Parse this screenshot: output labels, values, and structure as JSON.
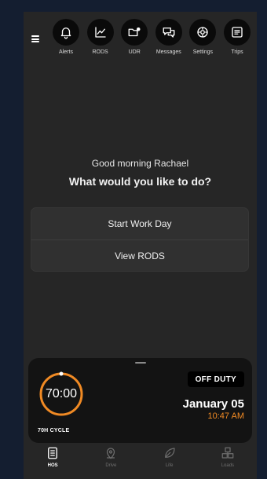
{
  "nav": {
    "items": [
      {
        "label": "Alerts",
        "icon": "bell-icon"
      },
      {
        "label": "RODS",
        "icon": "chart-icon"
      },
      {
        "label": "UDR",
        "icon": "folder-alert-icon"
      },
      {
        "label": "Messages",
        "icon": "chat-icon"
      },
      {
        "label": "Settings",
        "icon": "gear-icon"
      },
      {
        "label": "Trips",
        "icon": "list-icon"
      }
    ]
  },
  "main": {
    "greeting": "Good morning Rachael",
    "question": "What would you like to do?",
    "actions": {
      "start": "Start Work Day",
      "view": "View RODS"
    }
  },
  "status": {
    "timer": "70:00",
    "cycle": "70H CYCLE",
    "duty": "OFF DUTY",
    "date": "January 05",
    "time": "10:47 AM"
  },
  "tabs": [
    {
      "label": "HOS",
      "icon": "document-icon",
      "active": true
    },
    {
      "label": "Drive",
      "icon": "map-pin-icon",
      "active": false
    },
    {
      "label": "Life",
      "icon": "leaf-icon",
      "active": false
    },
    {
      "label": "Loads",
      "icon": "boxes-icon",
      "active": false
    }
  ],
  "colors": {
    "accent": "#f08a24",
    "background": "#262626",
    "sheet": "#131313"
  }
}
